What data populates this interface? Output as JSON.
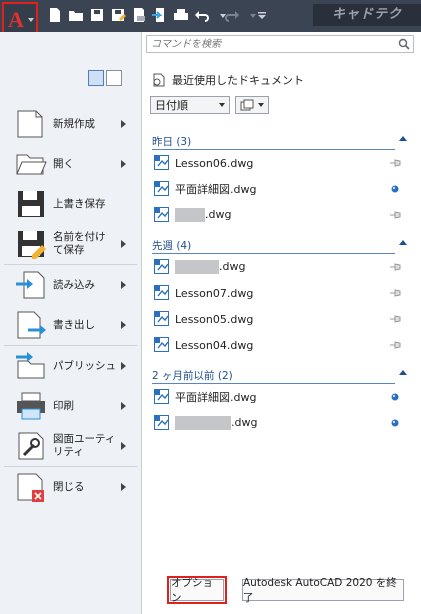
{
  "qat": {
    "brand_text": "キャドテク",
    "icons": [
      "new-icon",
      "open-icon",
      "save-icon",
      "save-as-icon",
      "print-preview-icon",
      "export-icon",
      "print-icon",
      "undo-icon",
      "redo-icon",
      "customize-icon"
    ]
  },
  "search": {
    "placeholder": "コマンドを検索"
  },
  "recent": {
    "title": "最近使用したドキュメント",
    "sort_label": "日付順"
  },
  "menu": [
    {
      "label": "新規作成",
      "arrow": true
    },
    {
      "label": "開く",
      "arrow": true
    },
    {
      "label": "上書き保存",
      "arrow": false
    },
    {
      "label": "名前を付け\nて保存",
      "arrow": true
    },
    {
      "label": "読み込み",
      "arrow": true
    },
    {
      "label": "書き出し",
      "arrow": true
    },
    {
      "label": "パブリッシュ",
      "arrow": true
    },
    {
      "label": "印刷",
      "arrow": true
    },
    {
      "label": "図面ユーティ\nリティ",
      "arrow": true
    },
    {
      "label": "閉じる",
      "arrow": true
    }
  ],
  "groups": [
    {
      "title": "昨日 (3)",
      "files": [
        {
          "name": "Lesson06.dwg",
          "pinned": false,
          "redacted": false
        },
        {
          "name": "平面詳細図.dwg",
          "pinned": true,
          "redacted": false
        },
        {
          "name": ".dwg",
          "pinned": false,
          "redacted": true,
          "redact_w": 30
        }
      ]
    },
    {
      "title": "先週 (4)",
      "files": [
        {
          "name": ".dwg",
          "pinned": false,
          "redacted": true,
          "redact_w": 44
        },
        {
          "name": "Lesson07.dwg",
          "pinned": false,
          "redacted": false
        },
        {
          "name": "Lesson05.dwg",
          "pinned": false,
          "redacted": false
        },
        {
          "name": "Lesson04.dwg",
          "pinned": false,
          "redacted": false
        }
      ]
    },
    {
      "title": "2 ヶ月前以前 (2)",
      "files": [
        {
          "name": "平面詳細図.dwg",
          "pinned": true,
          "redacted": false
        },
        {
          "name": ".dwg",
          "pinned": true,
          "redacted": true,
          "redact_w": 56
        }
      ]
    }
  ],
  "footer": {
    "options_label": "オプション",
    "exit_label": "Autodesk AutoCAD 2020 を終了"
  },
  "colors": {
    "highlight": "#e0201b",
    "group_title": "#1f4f8f",
    "menu_bg": "#eef1f5"
  }
}
